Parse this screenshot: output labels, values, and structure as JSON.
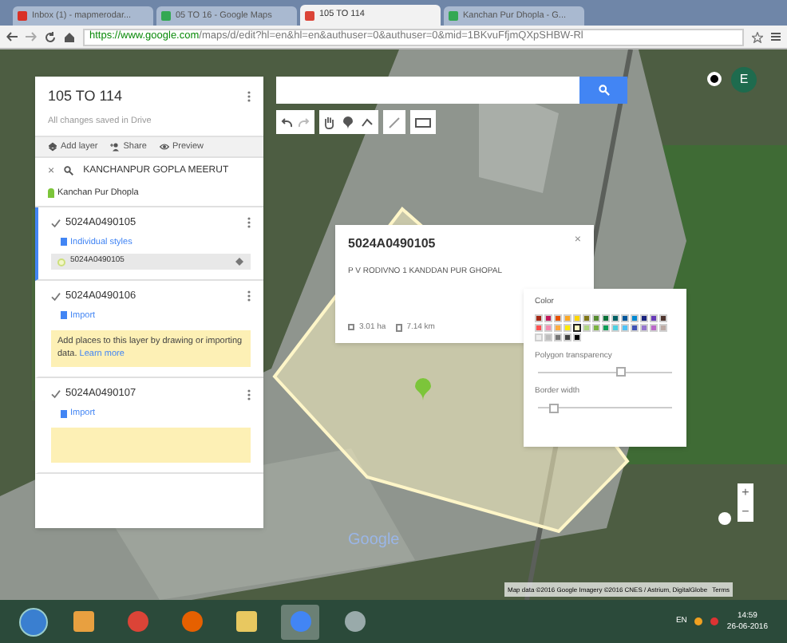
{
  "browser": {
    "tabs": [
      {
        "label": "Inbox (1) - mapmerodar...",
        "selected": false,
        "kind": "mail"
      },
      {
        "label": "05 TO 16 - Google Maps",
        "selected": false,
        "kind": "maps"
      },
      {
        "label": "105 TO 114",
        "selected": true,
        "kind": "mymaps"
      },
      {
        "label": "Kanchan Pur Dhopla - G...",
        "selected": false,
        "kind": "maps"
      }
    ],
    "url_host": "https://www.google.com",
    "url_path": "/maps/d/edit?hl=en&hl=en&authuser=0&authuser=0&mid=1BKvuFfjmQXpSHBW-Rl"
  },
  "panel": {
    "title": "105 TO 114",
    "saved": "All changes saved in Drive",
    "actions": [
      "Add layer",
      "Share",
      "Preview"
    ],
    "layers": [
      {
        "kind": "search",
        "title": "KANCHANPUR GOPLA MEERUT",
        "close": "×",
        "items": [
          {
            "label": "Kanchan Pur Dhopla",
            "selected": false
          }
        ]
      },
      {
        "kind": "layer",
        "title": "5024A0490105",
        "checked": true,
        "active": true,
        "link": "Individual styles",
        "items": [
          {
            "label": "5024A0490105",
            "selected": true
          }
        ]
      },
      {
        "kind": "layer",
        "title": "5024A0490106",
        "checked": true,
        "active": false,
        "link": "Import",
        "note": "Add places to this layer by drawing or importing data.",
        "note_link": "Learn more"
      },
      {
        "kind": "layer",
        "title": "5024A0490107",
        "checked": true,
        "active": false,
        "link": "Import",
        "note_box": true
      }
    ]
  },
  "info_card": {
    "title": "5024A0490105",
    "description": "P V RODIVNO 1 KANDDAN PUR GHOPAL",
    "area": "3.01 ha",
    "perimeter": "7.14 km",
    "close": "×"
  },
  "style_popup": {
    "color_label": "Color",
    "swatches": [
      {
        "color": "#a52714",
        "selected": false
      },
      {
        "color": "#c2185b",
        "selected": false
      },
      {
        "color": "#e65100",
        "selected": false
      },
      {
        "color": "#f9a825",
        "selected": false
      },
      {
        "color": "#ffd600",
        "selected": false
      },
      {
        "color": "#817717",
        "selected": false
      },
      {
        "color": "#558b2f",
        "selected": false
      },
      {
        "color": "#097138",
        "selected": false
      },
      {
        "color": "#006064",
        "selected": false
      },
      {
        "color": "#01579b",
        "selected": false
      },
      {
        "color": "#0288d1",
        "selected": false
      },
      {
        "color": "#1a237e",
        "selected": false
      },
      {
        "color": "#673ab7",
        "selected": false
      },
      {
        "color": "#4e342e",
        "selected": false
      },
      {
        "color": "#ff5252",
        "selected": false
      },
      {
        "color": "#f48fb1",
        "selected": false
      },
      {
        "color": "#ffab40",
        "selected": false
      },
      {
        "color": "#ffea00",
        "selected": false
      },
      {
        "color": "#fff9c4",
        "selected": true
      },
      {
        "color": "#aed581",
        "selected": false
      },
      {
        "color": "#7cb342",
        "selected": false
      },
      {
        "color": "#0f9d58",
        "selected": false
      },
      {
        "color": "#4dd0e1",
        "selected": false
      },
      {
        "color": "#4fc3f7",
        "selected": false
      },
      {
        "color": "#3f51b5",
        "selected": false
      },
      {
        "color": "#9575cd",
        "selected": false
      },
      {
        "color": "#ba68c8",
        "selected": false
      },
      {
        "color": "#bcaaa4",
        "selected": false
      },
      {
        "color": "#eeeeee",
        "selected": false
      },
      {
        "color": "#bdbdbd",
        "selected": false
      },
      {
        "color": "#757575",
        "selected": false
      },
      {
        "color": "#424242",
        "selected": false
      },
      {
        "color": "#000000",
        "selected": false
      }
    ],
    "sliders": [
      {
        "label": "Polygon transparency",
        "level": 0.62
      },
      {
        "label": "Border width",
        "level": 0.12
      }
    ]
  },
  "map": {
    "logo": "Google",
    "attribution": "Map data ©2016 Google Imagery ©2016 CNES / Astrium, DigitalGlobe",
    "terms": "Terms",
    "zoom_in": "+",
    "zoom_out": "−",
    "account_initial": "E"
  },
  "taskbar": {
    "apps": [
      {
        "kind": "media",
        "active": false
      },
      {
        "kind": "chrome",
        "active": false
      },
      {
        "kind": "firefox",
        "active": false
      },
      {
        "kind": "folder",
        "active": false
      },
      {
        "kind": "chrome-window",
        "active": true
      },
      {
        "kind": "app",
        "active": false
      }
    ],
    "language": "EN",
    "time": "14:59",
    "date": "26-06-2016"
  }
}
